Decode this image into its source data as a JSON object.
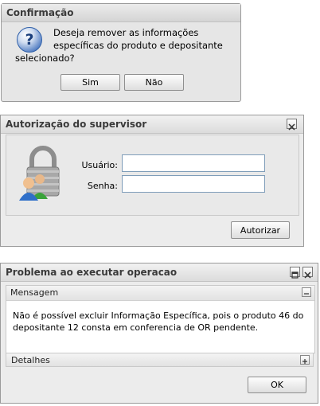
{
  "confirm": {
    "title": "Confirmação",
    "message_line1": "Deseja remover as informações",
    "message_line2": "específicas do produto e depositante",
    "message_line3": "selecionado?",
    "yes_label": "Sim",
    "no_label": "Não"
  },
  "auth": {
    "title": "Autorização do supervisor",
    "user_label": "Usuário:",
    "user_value": "",
    "password_label": "Senha:",
    "password_value": "",
    "authorize_label": "Autorizar"
  },
  "problem": {
    "title": "Problema ao executar operacao",
    "message_section": "Mensagem",
    "message_line1": "Não é possível excluir Informação Específica, pois o produto 46 do",
    "message_line2": "depositante 12 consta em conferencia de OR pendente.",
    "details_section": "Detalhes",
    "ok_label": "OK"
  },
  "colors": {
    "question_icon": "#2f5fa8",
    "lock_body": "#9a9a9a",
    "user_shirt_1": "#2f6fc9",
    "user_shirt_2": "#3aa33a"
  }
}
